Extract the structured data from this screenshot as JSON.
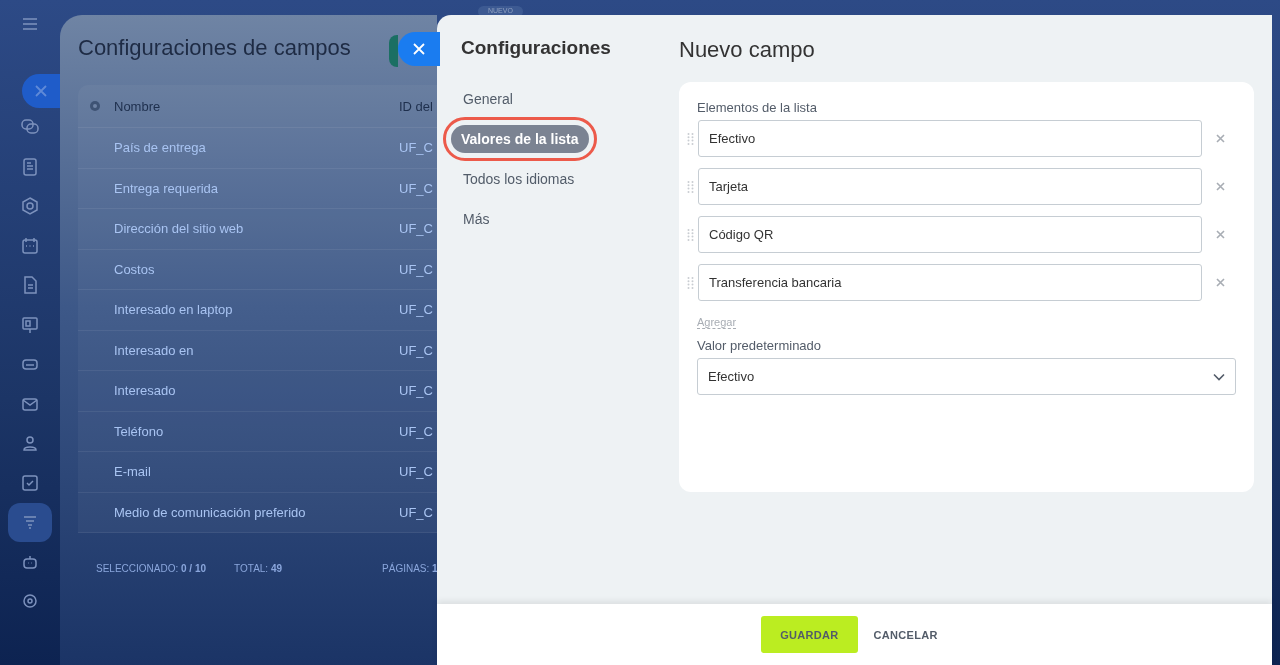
{
  "background_page": {
    "title": "Configuraciones de campos",
    "columns": [
      "Nombre",
      "ID del"
    ],
    "rows": [
      {
        "name": "País de entrega",
        "id": "UF_C"
      },
      {
        "name": "Entrega requerida",
        "id": "UF_C"
      },
      {
        "name": "Dirección del sitio web",
        "id": "UF_C"
      },
      {
        "name": "Costos",
        "id": "UF_C"
      },
      {
        "name": "Interesado en laptop",
        "id": "UF_C"
      },
      {
        "name": "Interesado en",
        "id": "UF_C"
      },
      {
        "name": "Interesado",
        "id": "UF_C"
      },
      {
        "name": "Teléfono",
        "id": "UF_C"
      },
      {
        "name": "E-mail",
        "id": "UF_C"
      },
      {
        "name": "Medio de comunicación preferido",
        "id": "UF_C"
      }
    ],
    "footer": [
      "SELECCIONADO: **0 / 10**",
      "TOTAL: **49**",
      "PÁGINAS: **1**"
    ]
  },
  "badge": "NUEVO",
  "panel": {
    "nav_title": "Configuraciones",
    "nav": [
      {
        "label": "General",
        "selected": false
      },
      {
        "label": "Valores de la lista",
        "selected": true
      },
      {
        "label": "Todos los idiomas",
        "selected": false
      },
      {
        "label": "Más",
        "selected": false
      }
    ],
    "title": "Nuevo campo",
    "list_label": "Elementos de la lista",
    "items": [
      "Efectivo",
      "Tarjeta",
      "Código QR",
      "Transferencia bancaria"
    ],
    "add_link": "Agregar",
    "default_label": "Valor predeterminado",
    "default_value": "Efectivo",
    "buttons": [
      {
        "label": "GUARDAR",
        "kind": "primary"
      },
      {
        "label": "CANCELAR",
        "kind": "link"
      }
    ]
  }
}
